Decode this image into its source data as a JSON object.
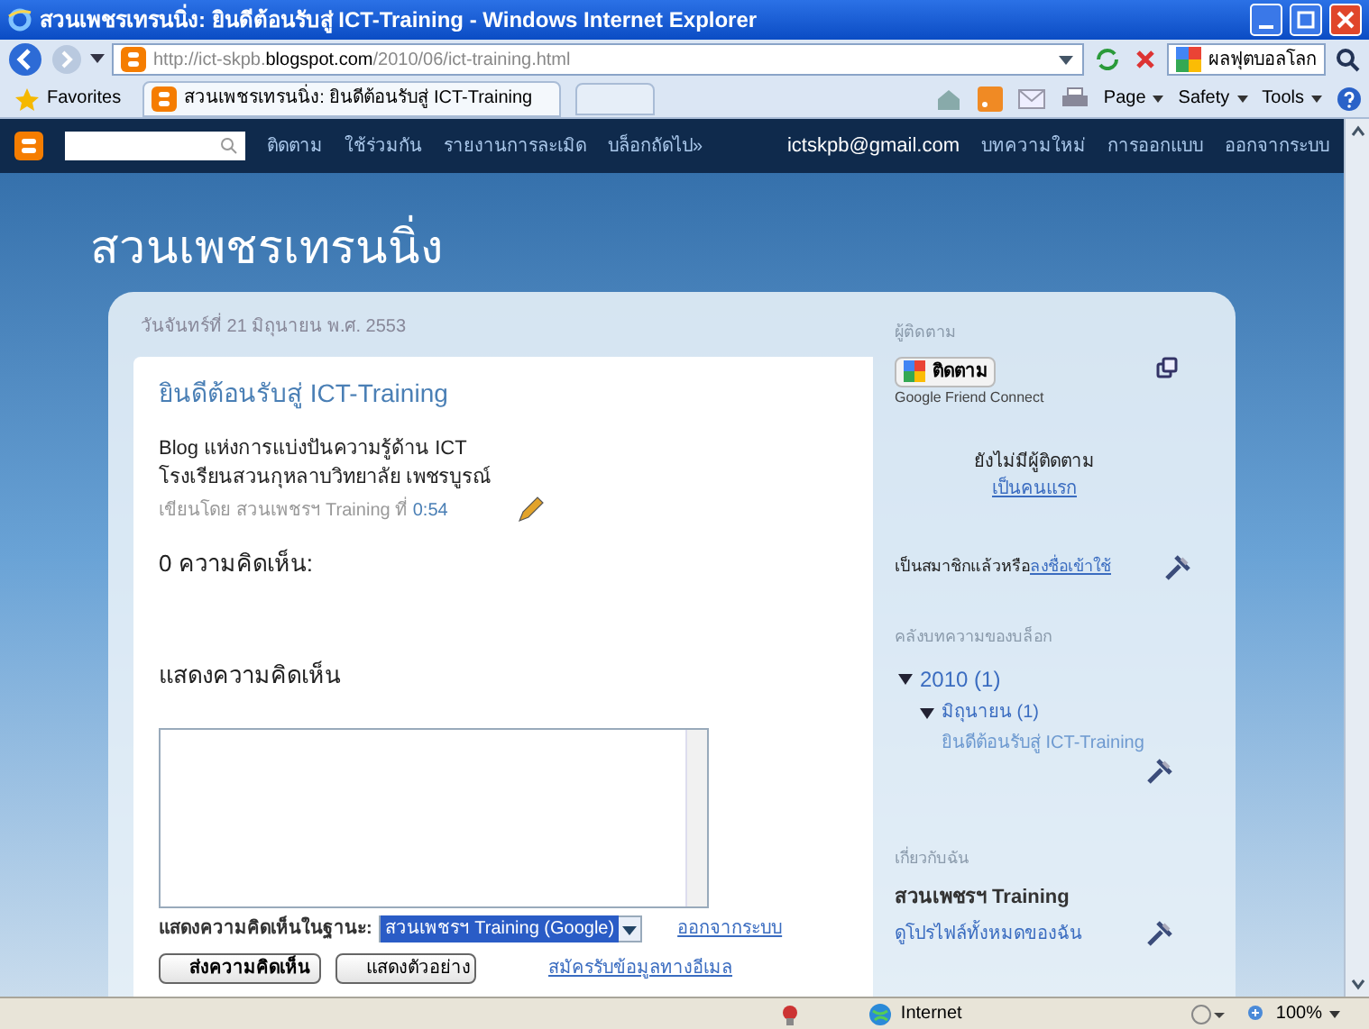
{
  "window": {
    "title": "สวนเพชรเทรนนิ่ง: ยินดีต้อนรับสู่ ICT-Training - Windows Internet Explorer"
  },
  "browser": {
    "address_host_prefix": "http://ict-skpb.",
    "address_host": "blogspot.com",
    "address_path": "/2010/06/ict-training.html",
    "search_text": "ผลฟุตบอลโลก",
    "favorites": "Favorites",
    "tab_title": "สวนเพชรเทรนนิ่ง: ยินดีต้อนรับสู่ ICT-Training",
    "menus": [
      "Page",
      "Safety",
      "Tools"
    ]
  },
  "navbar": {
    "links": [
      "ติดตาม",
      "ใช้ร่วมกัน",
      "รายงานการละเมิด",
      "บล็อกถัดไป»"
    ],
    "email": "ictskpb@gmail.com",
    "right_links": [
      "บทความใหม่",
      "การออกแบบ",
      "ออกจากระบบ"
    ]
  },
  "blog": {
    "title": "สวนเพชรเทรนนิ่ง"
  },
  "post": {
    "date": "วันจันทร์ที่ 21 มิถุนายน พ.ศ. 2553",
    "title": "ยินดีต้อนรับสู่ ICT-Training",
    "body_lines": [
      "Blog แห่งการแบ่งปันความรู้ด้าน ICT",
      "โรงเรียนสวนกุหลาบวิทยาลัย เพชรบูรณ์"
    ],
    "byline": "เขียนโดย สวนเพชรฯ Training ที่",
    "time": "0:54",
    "comments_count": "0 ความคิดเห็น:",
    "comment_heading": "แสดงความคิดเห็น",
    "comment_as": "แสดงความคิดเห็นในฐานะ:",
    "identity": "สวนเพชรฯ Training (Google)",
    "sign_out": "ออกจากระบบ",
    "buttons": [
      "ส่งความคิดเห็น",
      "แสดงตัวอย่าง"
    ],
    "subscribe": "สมัครรับข้อมูลทางอีเมล"
  },
  "sidebar": {
    "followers_title": "ผู้ติดตาม",
    "follow_button": "ติดตาม",
    "gfc": "Google Friend Connect",
    "no_followers": "ยังไม่มีผู้ติดตาม",
    "be_first": "เป็นคนแรก",
    "member_text": "เป็นสมาชิกแล้วหรือ",
    "sign_in": "ลงชื่อเข้าใช้",
    "archive_title": "คลังบทความของบล็อก",
    "archive": [
      {
        "label": "2010 (1)",
        "expanded": true,
        "children": [
          {
            "label": "มิถุนายน (1)",
            "expanded": true,
            "children": [
              {
                "label": "ยินดีต้อนรับสู่ ICT-Training"
              }
            ]
          }
        ]
      }
    ],
    "about_title": "เกี่ยวกับฉัน",
    "name": "สวนเพชรฯ Training",
    "profile_link": "ดูโปรไฟล์ทั้งหมดของฉัน"
  },
  "status_bar": {
    "zone": "Internet",
    "zoom": "100%"
  }
}
